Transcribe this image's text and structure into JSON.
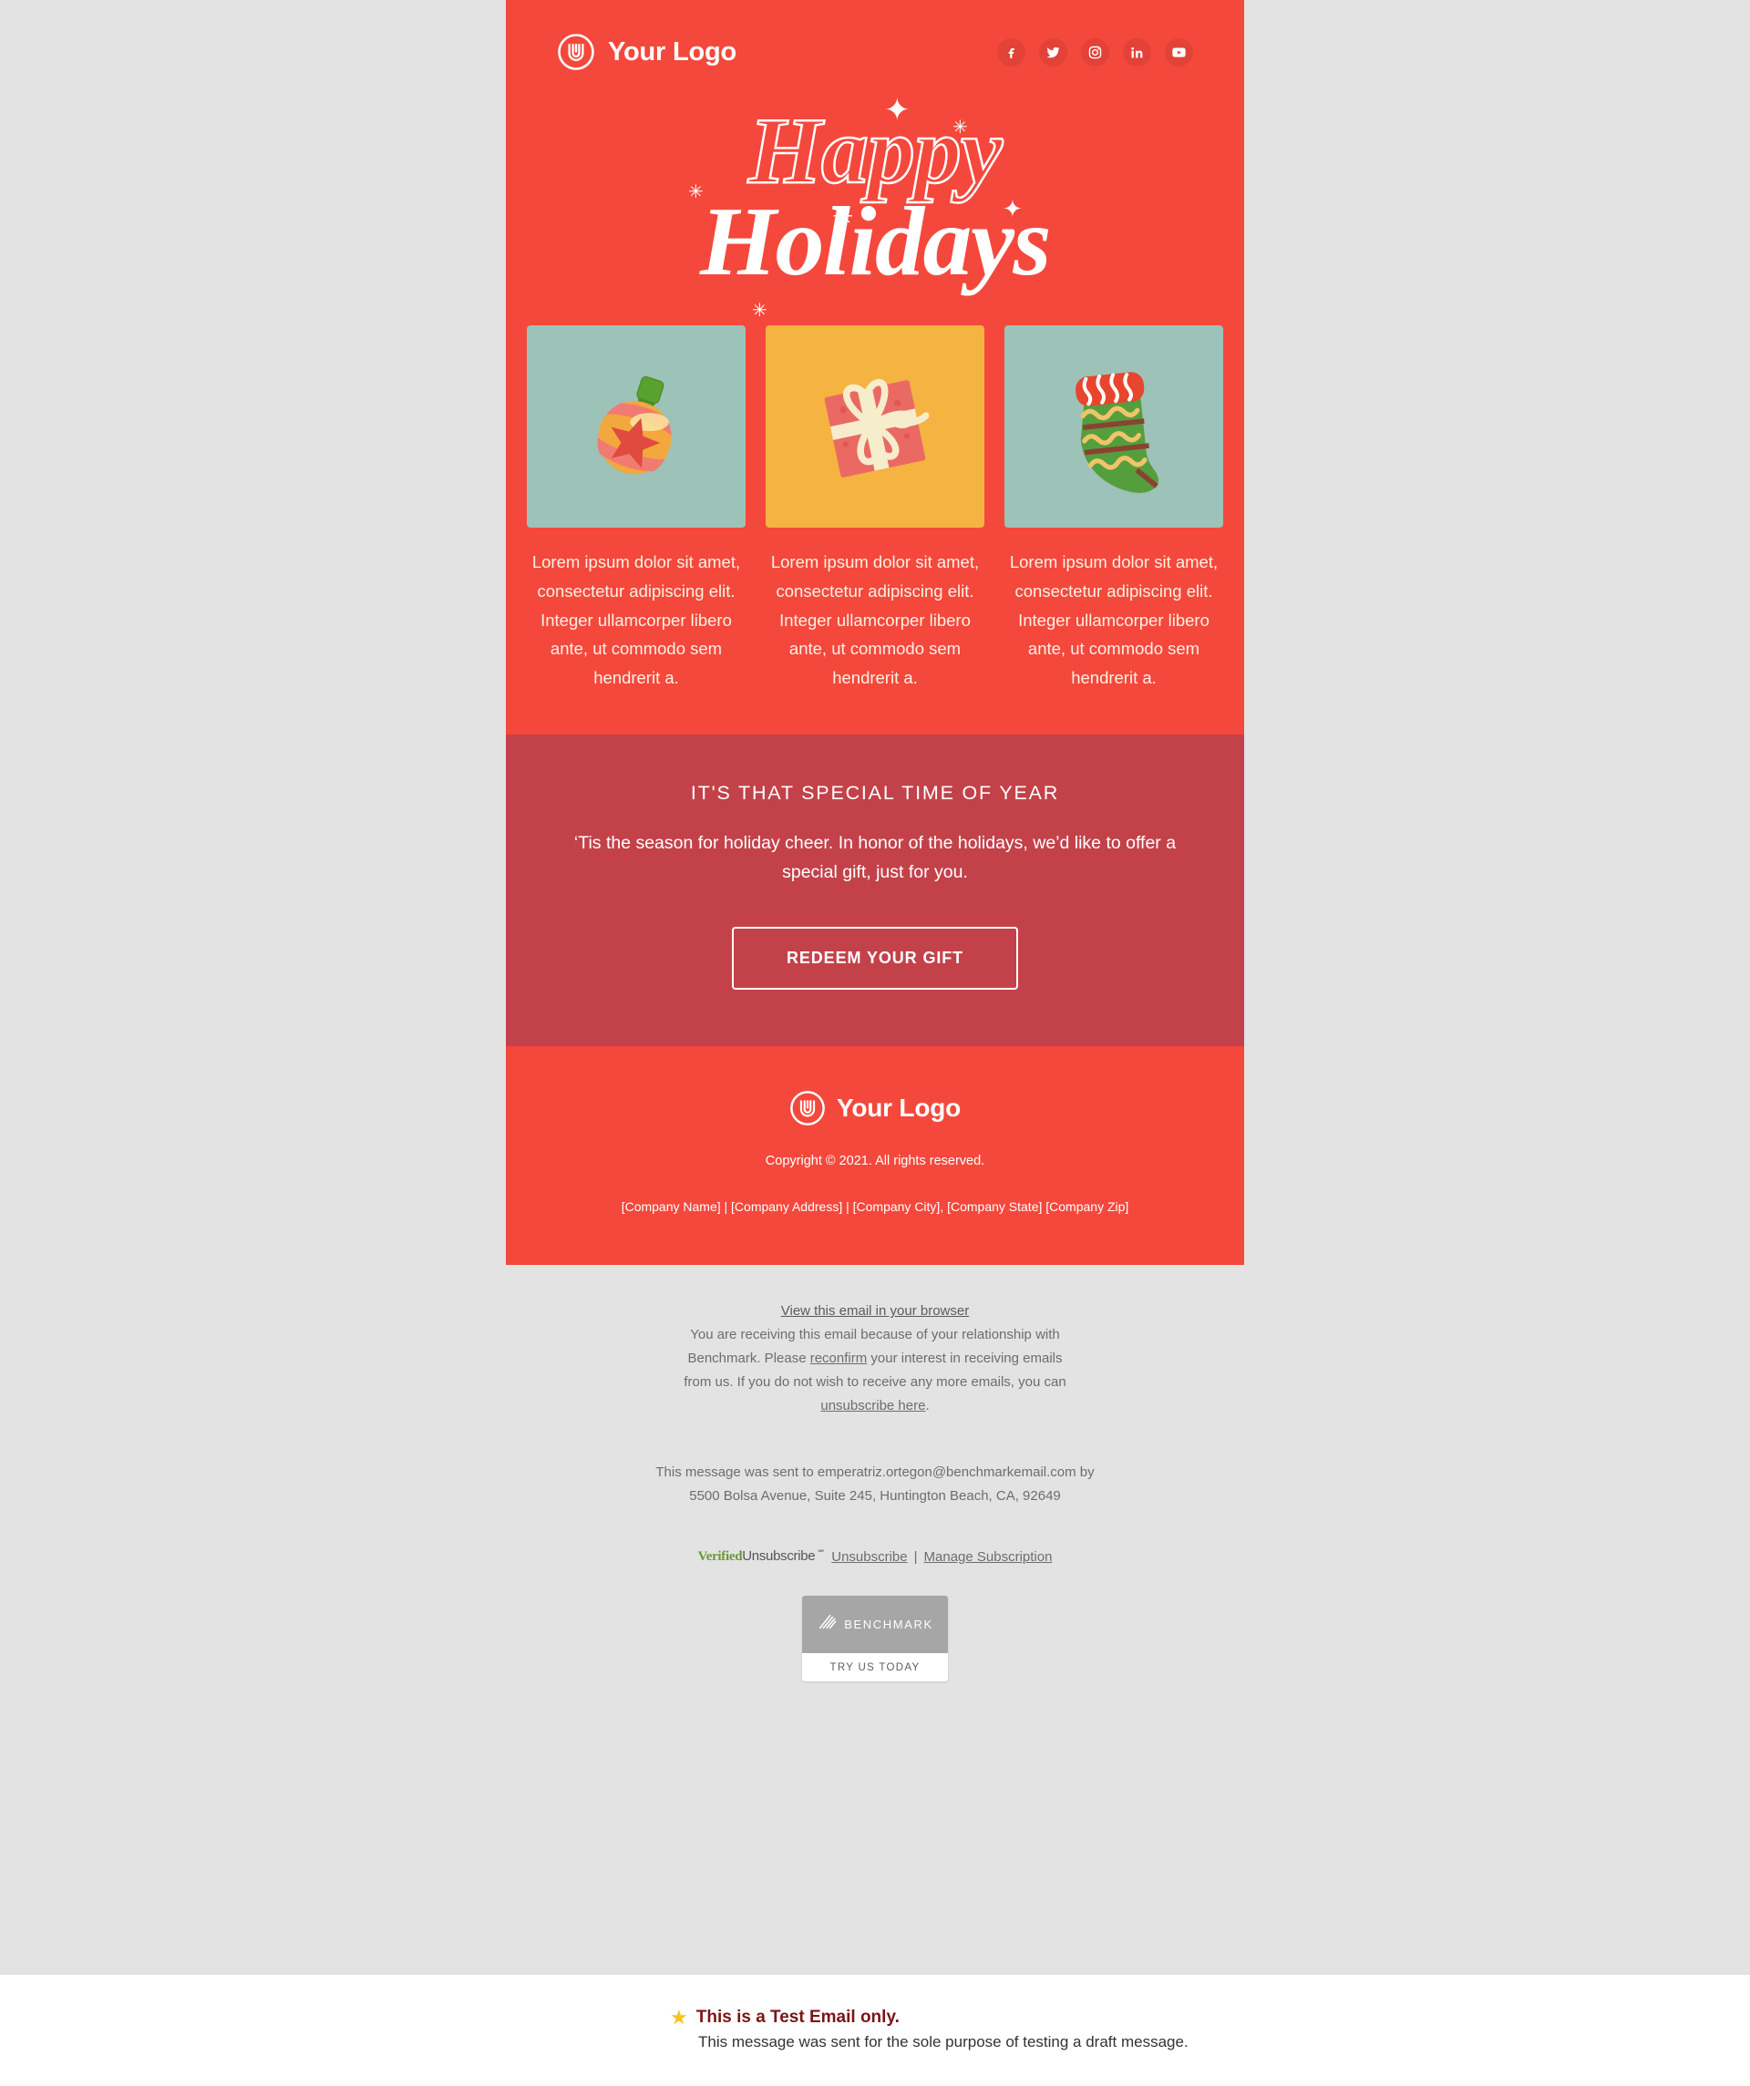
{
  "colors": {
    "brand_red": "#F4483C",
    "cta_band_red": "#C3424A",
    "page_grey": "#E3E3E3",
    "card_sage": "#9DC2B8",
    "card_amber": "#F5B342",
    "test_title_red": "#7B1418",
    "verified_green": "#6A9A3C"
  },
  "header": {
    "logo_name": "Your Logo",
    "logo_icon": "arch-circle-logo-icon",
    "socials": [
      {
        "name": "facebook",
        "icon": "facebook-icon"
      },
      {
        "name": "twitter",
        "icon": "twitter-icon"
      },
      {
        "name": "instagram",
        "icon": "instagram-icon"
      },
      {
        "name": "linkedin",
        "icon": "linkedin-icon"
      },
      {
        "name": "youtube",
        "icon": "youtube-icon"
      }
    ]
  },
  "hero": {
    "line1": "Happy",
    "line2": "Holidays",
    "sparkles": [
      "✦",
      "✳",
      "✳",
      "✦",
      "✳",
      "✳"
    ]
  },
  "cards": [
    {
      "image_icon": "christmas-ornament-icon",
      "image_alt": "Striped Christmas ornament bauble with star",
      "bg": "#9DC2B8",
      "text": "Lorem ipsum dolor sit amet, consectetur adipiscing elit. Integer ullamcorper libero ante, ut commodo sem hendrerit a."
    },
    {
      "image_icon": "gift-box-icon",
      "image_alt": "Red gift box with cream ribbon bow",
      "bg": "#F5B342",
      "text": "Lorem ipsum dolor sit amet, consectetur adipiscing elit. Integer ullamcorper libero ante, ut commodo sem hendrerit a."
    },
    {
      "image_icon": "christmas-stocking-icon",
      "image_alt": "Green Christmas stocking with red cuff",
      "bg": "#9DC2B8",
      "text": "Lorem ipsum dolor sit amet, consectetur adipiscing elit. Integer ullamcorper libero ante, ut commodo sem hendrerit a."
    }
  ],
  "cta": {
    "title": "IT'S THAT SPECIAL TIME OF YEAR",
    "subtitle": "‘Tis the season for holiday cheer. In honor of the holidays, we’d like to offer a special gift, just for you.",
    "button_label": "REDEEM YOUR GIFT"
  },
  "email_footer": {
    "logo_name": "Your Logo",
    "copyright": "Copyright © 2021. All rights reserved.",
    "address": "[Company Name] | [Company Address] | [Company City], [Company State] [Company Zip]"
  },
  "outer_footer": {
    "view_browser": "View this email in your browser",
    "receiving_part1": "You are receiving this email because of your relationship with Benchmark. Please ",
    "receiving_link1": "reconfirm",
    "receiving_part2": " your interest in receiving emails from us. If you do not wish to receive any more emails, you can ",
    "receiving_link2": "unsubscribe here",
    "receiving_part3": ".",
    "sent_to_line1": "This message was sent to emperatriz.ortegon@benchmarkemail.com by",
    "sent_to_line2": "5500 Bolsa Avenue, Suite 245, Huntington Beach, CA, 92649",
    "verified_badge_verified": "Verified",
    "verified_badge_unsubscribe": "Unsubscribe",
    "verified_badge_sm": "℠",
    "unsubscribe_link": "Unsubscribe",
    "separator": "|",
    "manage_link": "Manage Subscription",
    "benchmark_name": "BENCHMARK",
    "benchmark_cta": "TRY US TODAY"
  },
  "test_notice": {
    "star_icon": "star-icon",
    "title": "This is a Test Email only.",
    "body": "This message was sent for the sole purpose of testing a draft message."
  }
}
